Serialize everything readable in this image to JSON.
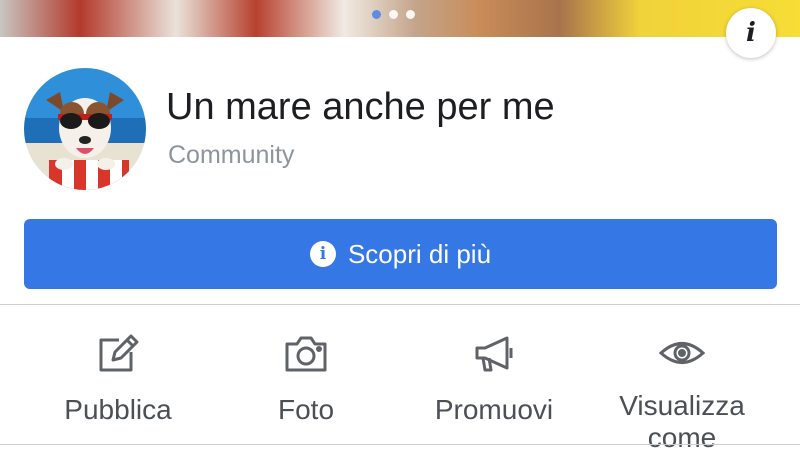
{
  "cover": {
    "slide_count": 3,
    "active_slide": 1
  },
  "info_button": {
    "glyph": "i",
    "icon": "info-icon"
  },
  "profile": {
    "title": "Un mare anche per me",
    "category": "Community",
    "avatar_icon": "dog-sunglasses-avatar"
  },
  "cta": {
    "label": "Scopri di più",
    "icon": "info-circle-icon",
    "color": "#3578e5"
  },
  "actions": [
    {
      "label": "Pubblica",
      "icon": "edit-icon"
    },
    {
      "label": "Foto",
      "icon": "camera-icon"
    },
    {
      "label": "Promuovi",
      "icon": "megaphone-icon"
    },
    {
      "label": "Visualizza come",
      "icon": "eye-icon"
    }
  ]
}
